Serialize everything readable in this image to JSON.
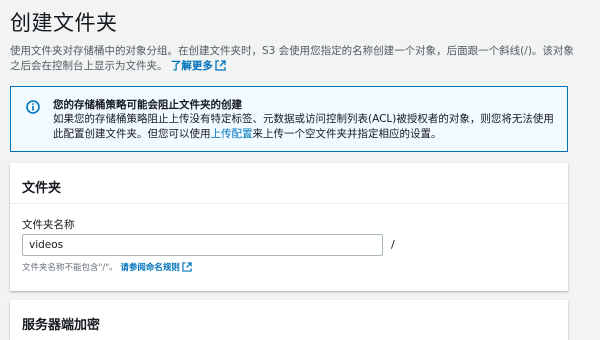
{
  "page": {
    "title": "创建文件夹",
    "description_part1": "使用文件夹对存储桶中的对象分组。在创建文件夹时，S3 会使用您指定的名称创建一个对象，后面跟一个斜线(/)。该对象之后会在控制台上显示为文件夹。",
    "learn_more": "了解更多"
  },
  "info": {
    "title": "您的存储桶策略可能会阻止文件夹的创建",
    "body_part1": "如果您的存储桶策略阻止上传没有特定标签、元数据或访问控制列表(ACL)被授权者的对象，则您将无法使用此配置创建文件夹。但您可以使用",
    "link": "上传配置",
    "body_part2": "来上传一个空文件夹并指定相应的设置。"
  },
  "folder_panel": {
    "header": "文件夹",
    "field_label": "文件夹名称",
    "field_value": "videos",
    "suffix": "/",
    "hint_text": "文件夹名称不能包含\"/\"。",
    "hint_link": "请参阅命名规则"
  },
  "encryption_panel": {
    "header": "服务器端加密"
  },
  "icons": {
    "info": "info-icon",
    "external": "external-link-icon"
  },
  "colors": {
    "link": "#0073bb",
    "info_bg": "#f1faff",
    "info_border": "#0073bb"
  }
}
